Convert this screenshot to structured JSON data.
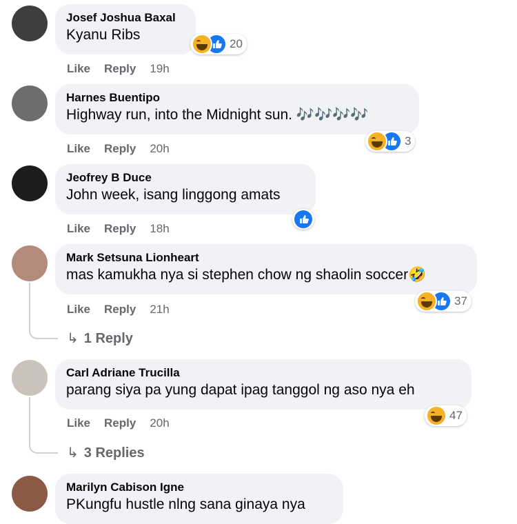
{
  "actions": {
    "like": "Like",
    "reply": "Reply"
  },
  "comments": [
    {
      "author": "Josef Joshua Baxal",
      "text": "Kyanu Ribs",
      "time": "19h",
      "reactions": [
        "haha",
        "like"
      ],
      "count": "20"
    },
    {
      "author": "Harnes Buentipo",
      "text": "Highway run, into the Midnight sun. 🎶🎶🎶🎶",
      "time": "20h",
      "reactions": [
        "haha",
        "like"
      ],
      "count": "3"
    },
    {
      "author": "Jeofrey B Duce",
      "text": "John week, isang linggong amats",
      "time": "18h",
      "reactions": [
        "like"
      ],
      "count": ""
    },
    {
      "author": "Mark Setsuna Lionheart",
      "text": "mas kamukha nya si stephen chow ng shaolin soccer🤣",
      "time": "21h",
      "reactions": [
        "haha",
        "like"
      ],
      "count": "37",
      "replies": "1 Reply"
    },
    {
      "author": "Carl Adriane Trucilla",
      "text": "parang siya pa yung dapat ipag tanggol ng aso nya eh",
      "time": "20h",
      "reactions": [
        "haha"
      ],
      "count": "47",
      "replies": "3 Replies"
    },
    {
      "author": "Marilyn Cabison Igne",
      "text": "PKungfu hustle nlng sana ginaya nya"
    }
  ]
}
